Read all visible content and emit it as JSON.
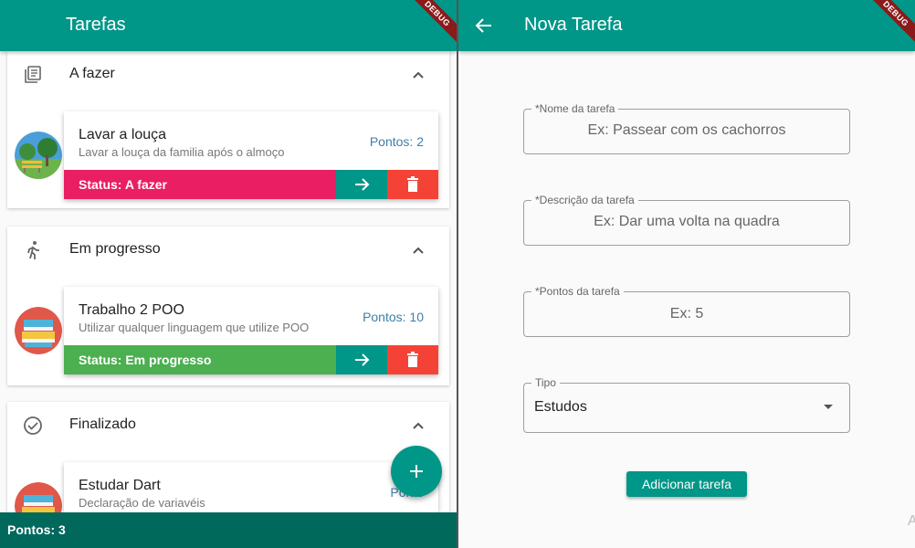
{
  "left": {
    "title": "Tarefas",
    "debug_label": "DEBUG",
    "sections": [
      {
        "title": "A fazer",
        "icon": "list-icon",
        "card": {
          "title": "Lavar a louça",
          "description": "Lavar a louça da familia após o almoço",
          "points": "Pontos: 2",
          "status": "Status: A fazer",
          "status_color": "#e91e63",
          "avatar": "park-icon"
        }
      },
      {
        "title": "Em progresso",
        "icon": "running-icon",
        "card": {
          "title": "Trabalho 2 POO",
          "description": "Utilizar qualquer linguagem que utilize POO",
          "points": "Pontos: 10",
          "status": "Status: Em progresso",
          "status_color": "#4caf50",
          "avatar": "books-icon"
        }
      },
      {
        "title": "Finalizado",
        "icon": "check-circle-icon",
        "card": {
          "title": "Estudar Dart",
          "description": "Declaração de variavéis",
          "points": "Ponto",
          "avatar": "books-icon"
        }
      }
    ],
    "footer": "Pontos: 3"
  },
  "right": {
    "title": "Nova Tarefa",
    "debug_label": "DEBUG",
    "fields": [
      {
        "label": "*Nome da tarefa",
        "hint": "Ex: Passear com os cachorros"
      },
      {
        "label": "*Descrição da tarefa",
        "hint": "Ex: Dar uma volta na quadra"
      },
      {
        "label": "*Pontos da tarefa",
        "hint": "Ex: 5"
      }
    ],
    "type_field": {
      "label": "Tipo",
      "value": "Estudos"
    },
    "submit_label": "Adicionar tarefa",
    "stray_text": "A"
  },
  "colors": {
    "primary": "#009688",
    "primary_dark": "#00695c",
    "danger": "#f44336"
  }
}
